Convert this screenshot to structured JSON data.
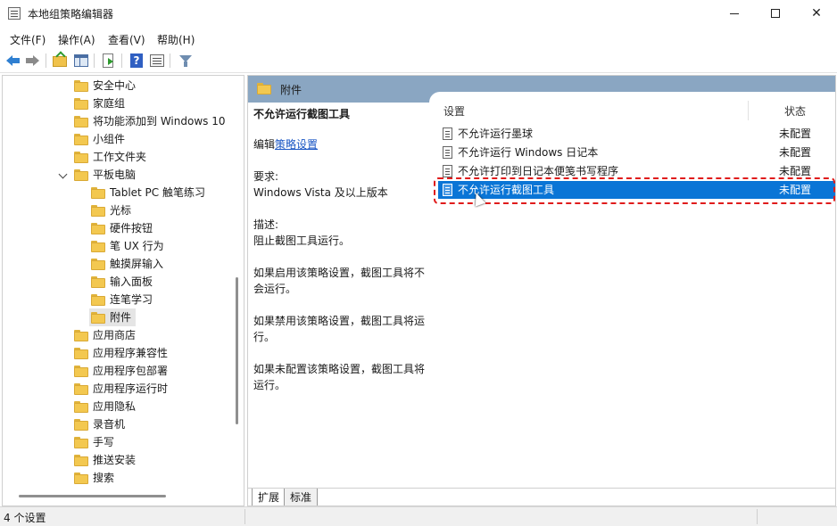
{
  "window": {
    "title": "本地组策略编辑器"
  },
  "menu": [
    "文件(F)",
    "操作(A)",
    "查看(V)",
    "帮助(H)"
  ],
  "toolbar": {
    "help_glyph": "?",
    "icons": [
      "back-arrow-icon",
      "forward-arrow-icon",
      "up-folder-icon",
      "show-hide-tree-icon",
      "export-list-icon",
      "help-icon",
      "properties-icon",
      "filter-icon"
    ]
  },
  "tree": {
    "items": [
      {
        "label": "安全中心",
        "level": 0
      },
      {
        "label": "家庭组",
        "level": 0
      },
      {
        "label": "将功能添加到 Windows 10",
        "level": 0
      },
      {
        "label": "小组件",
        "level": 0
      },
      {
        "label": "工作文件夹",
        "level": 0
      },
      {
        "label": "平板电脑",
        "level": 0,
        "expanded": true
      },
      {
        "label": "Tablet PC 触笔练习",
        "level": 1
      },
      {
        "label": "光标",
        "level": 1
      },
      {
        "label": "硬件按钮",
        "level": 1
      },
      {
        "label": "笔 UX 行为",
        "level": 1
      },
      {
        "label": "触摸屏输入",
        "level": 1
      },
      {
        "label": "输入面板",
        "level": 1
      },
      {
        "label": "连笔学习",
        "level": 1
      },
      {
        "label": "附件",
        "level": 1,
        "selected": true
      },
      {
        "label": "应用商店",
        "level": 0
      },
      {
        "label": "应用程序兼容性",
        "level": 0
      },
      {
        "label": "应用程序包部署",
        "level": 0
      },
      {
        "label": "应用程序运行时",
        "level": 0
      },
      {
        "label": "应用隐私",
        "level": 0
      },
      {
        "label": "录音机",
        "level": 0
      },
      {
        "label": "手写",
        "level": 0
      },
      {
        "label": "推送安装",
        "level": 0
      },
      {
        "label": "搜索",
        "level": 0
      }
    ]
  },
  "right": {
    "header_title": "附件",
    "description": {
      "title": "不允许运行截图工具",
      "edit_prefix": "编辑",
      "edit_link": "策略设置",
      "req_label": "要求:",
      "req_value": "Windows Vista 及以上版本",
      "desc_label": "描述:",
      "desc_value": "阻止截图工具运行。",
      "p_enabled": "如果启用该策略设置，截图工具将不会运行。",
      "p_disabled": "如果禁用该策略设置，截图工具将运行。",
      "p_notconfigured": "如果未配置该策略设置，截图工具将运行。"
    },
    "list": {
      "col_setting": "设置",
      "col_state": "状态",
      "rows": [
        {
          "name": "不允许运行墨球",
          "state": "未配置",
          "selected": false
        },
        {
          "name": "不允许运行 Windows 日记本",
          "state": "未配置",
          "selected": false
        },
        {
          "name": "不允许打印到日记本便笺书写程序",
          "state": "未配置",
          "selected": false
        },
        {
          "name": "不允许运行截图工具",
          "state": "未配置",
          "selected": true
        }
      ]
    },
    "tabs": [
      "扩展",
      "标准"
    ],
    "active_tab": "扩展"
  },
  "status": {
    "text": "4 个设置"
  },
  "colors": {
    "selection": "#0a75d6",
    "header_band": "#8aa6c2",
    "highlight_dash": "#e01b1b",
    "link": "#1a56c4"
  }
}
